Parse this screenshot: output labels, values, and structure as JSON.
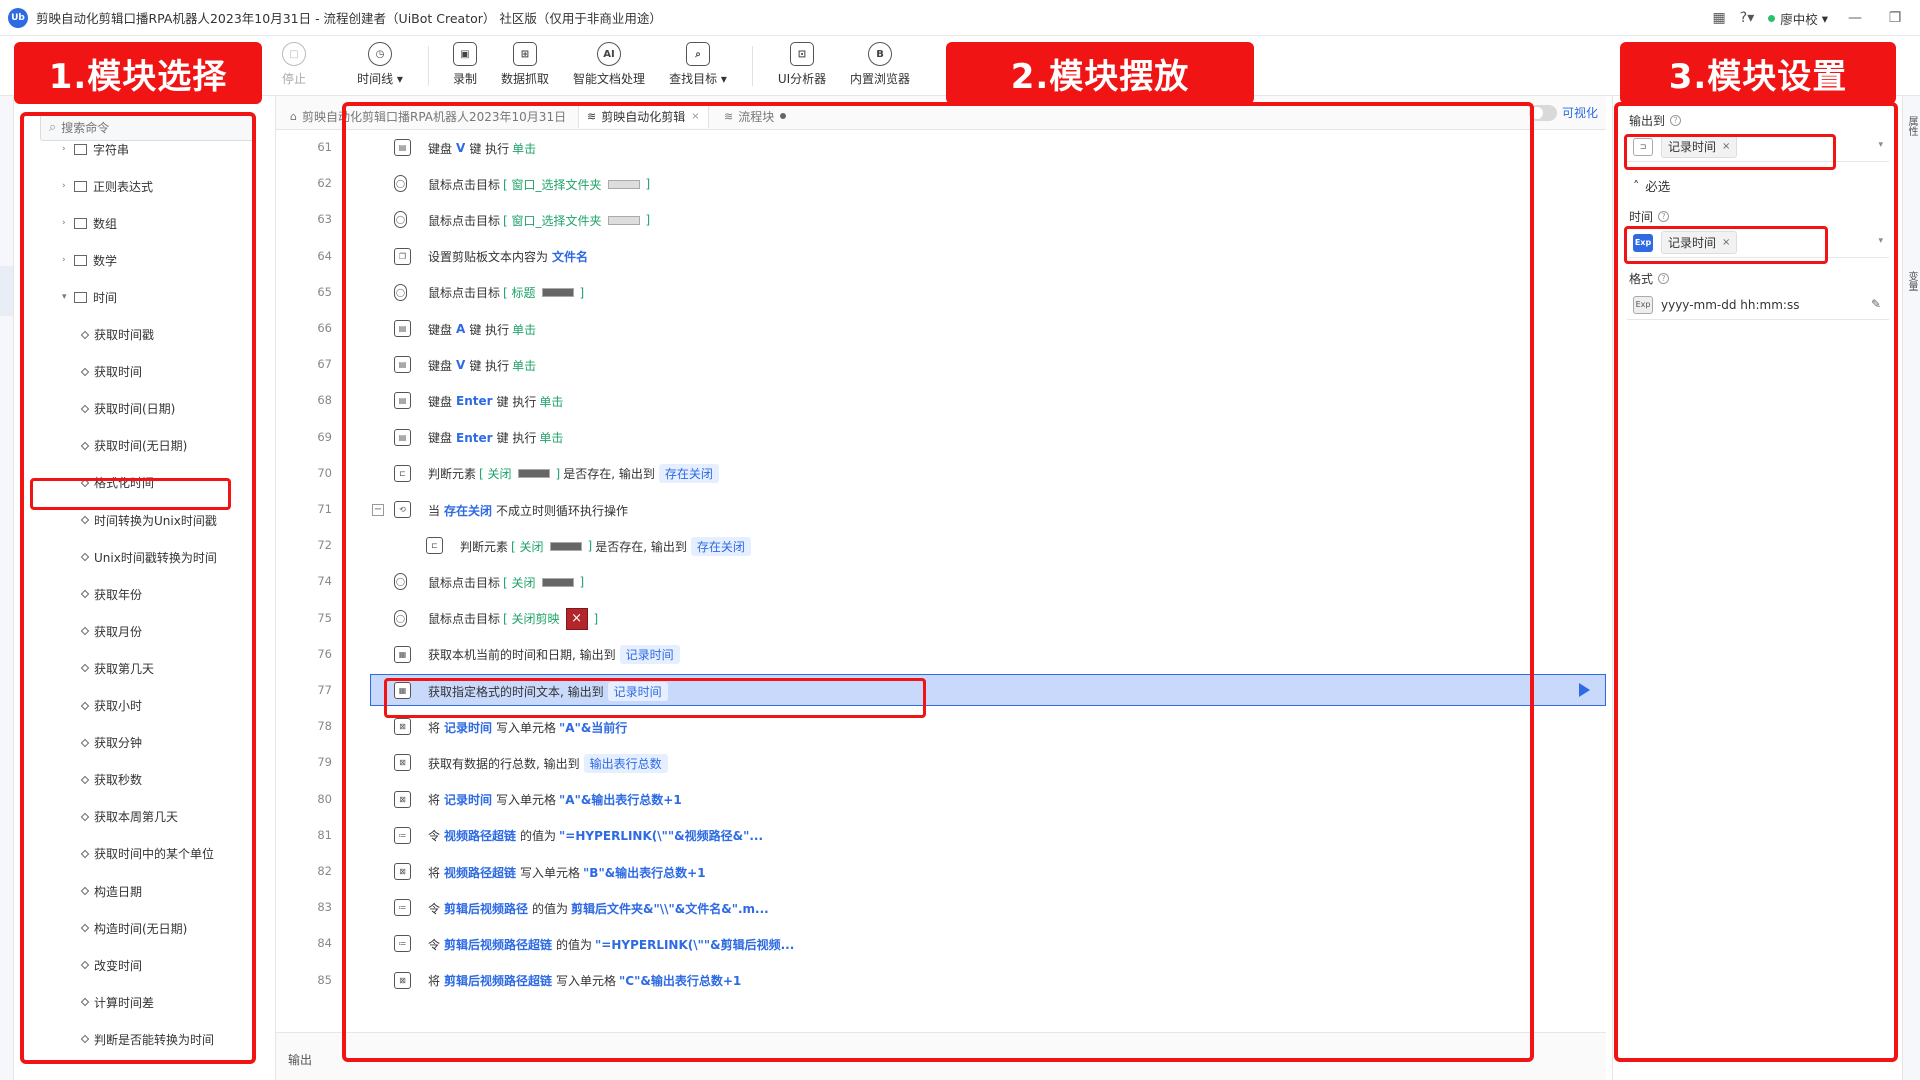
{
  "window": {
    "title": "剪映自动化剪辑口播RPA机器人2023年10月31日 - 流程创建者（UiBot Creator） 社区版（仅用于非商业用途）",
    "logo": "Ub",
    "user": "廖中校"
  },
  "toolbar": {
    "items": [
      {
        "label": "停止",
        "icon": "stop-icon",
        "glyph": "□"
      },
      {
        "label": "时间线 ▾",
        "icon": "clock-icon",
        "glyph": "◷"
      },
      {
        "label": "录制",
        "icon": "record-icon",
        "glyph": "▣"
      },
      {
        "label": "数据抓取",
        "icon": "data-grab-icon",
        "glyph": "⊞"
      },
      {
        "label": "智能文档处理",
        "icon": "ai-doc-icon",
        "glyph": "AI"
      },
      {
        "label": "查找目标 ▾",
        "icon": "find-target-icon",
        "glyph": "⌕"
      },
      {
        "label": "UI分析器",
        "icon": "ui-analyzer-icon",
        "glyph": "⊡"
      },
      {
        "label": "内置浏览器",
        "icon": "browser-icon",
        "glyph": "B"
      }
    ]
  },
  "annotations": {
    "panel1": "1.模块选择",
    "panel2": "2.模块摆放",
    "panel3": "3.模块设置"
  },
  "left": {
    "search_placeholder": "搜索命令",
    "tree": [
      {
        "label": "字符串",
        "kind": "folder"
      },
      {
        "label": "正则表达式",
        "kind": "folder"
      },
      {
        "label": "数组",
        "kind": "folder"
      },
      {
        "label": "数学",
        "kind": "folder"
      },
      {
        "label": "时间",
        "kind": "folder-open"
      },
      {
        "label": "获取时间戳",
        "kind": "leaf"
      },
      {
        "label": "获取时间",
        "kind": "leaf"
      },
      {
        "label": "获取时间(日期)",
        "kind": "leaf"
      },
      {
        "label": "获取时间(无日期)",
        "kind": "leaf"
      },
      {
        "label": "格式化时间",
        "kind": "leaf"
      },
      {
        "label": "时间转换为Unix时间戳",
        "kind": "leaf"
      },
      {
        "label": "Unix时间戳转换为时间",
        "kind": "leaf"
      },
      {
        "label": "获取年份",
        "kind": "leaf"
      },
      {
        "label": "获取月份",
        "kind": "leaf"
      },
      {
        "label": "获取第几天",
        "kind": "leaf"
      },
      {
        "label": "获取小时",
        "kind": "leaf"
      },
      {
        "label": "获取分钟",
        "kind": "leaf"
      },
      {
        "label": "获取秒数",
        "kind": "leaf"
      },
      {
        "label": "获取本周第几天",
        "kind": "leaf"
      },
      {
        "label": "获取时间中的某个单位",
        "kind": "leaf"
      },
      {
        "label": "构造日期",
        "kind": "leaf"
      },
      {
        "label": "构造时间(无日期)",
        "kind": "leaf"
      },
      {
        "label": "改变时间",
        "kind": "leaf"
      },
      {
        "label": "计算时间差",
        "kind": "leaf"
      },
      {
        "label": "判断是否能转换为时间",
        "kind": "leaf"
      }
    ]
  },
  "editor": {
    "tabs": [
      {
        "label": "剪映自动化剪辑口播RPA机器人2023年10月31日",
        "icon": "⌂"
      },
      {
        "label": "剪映自动化剪辑",
        "icon": "≋",
        "close": "×"
      },
      {
        "label": "流程块",
        "icon": "≋"
      }
    ],
    "visualize_label": "可视化",
    "output_label": "输出",
    "rows": [
      {
        "n": "61",
        "icon": "kbd",
        "parts": [
          [
            "t",
            "键盘"
          ],
          [
            "kw",
            "V"
          ],
          [
            "t",
            "键 执行"
          ],
          [
            "tg",
            "单击"
          ]
        ]
      },
      {
        "n": "62",
        "icon": "mouse",
        "parts": [
          [
            "t",
            "鼠标点击目标"
          ],
          [
            "tg",
            "[ 窗口_选择文件夹"
          ],
          [
            "thumbL",
            ""
          ],
          [
            "tg",
            "]"
          ]
        ]
      },
      {
        "n": "63",
        "icon": "mouse",
        "parts": [
          [
            "t",
            "鼠标点击目标"
          ],
          [
            "tg",
            "[ 窗口_选择文件夹"
          ],
          [
            "thumbL",
            ""
          ],
          [
            "tg",
            "]"
          ]
        ]
      },
      {
        "n": "64",
        "icon": "clip",
        "parts": [
          [
            "t",
            "设置剪贴板文本内容为"
          ],
          [
            "kw",
            "文件名"
          ]
        ]
      },
      {
        "n": "65",
        "icon": "mouse",
        "parts": [
          [
            "t",
            "鼠标点击目标"
          ],
          [
            "tg",
            "[ 标题"
          ],
          [
            "thumb",
            ""
          ],
          [
            "tg",
            "]"
          ]
        ]
      },
      {
        "n": "66",
        "icon": "kbd",
        "parts": [
          [
            "t",
            "键盘"
          ],
          [
            "kw",
            "A"
          ],
          [
            "t",
            "键 执行"
          ],
          [
            "tg",
            "单击"
          ]
        ]
      },
      {
        "n": "67",
        "icon": "kbd",
        "parts": [
          [
            "t",
            "键盘"
          ],
          [
            "kw",
            "V"
          ],
          [
            "t",
            "键 执行"
          ],
          [
            "tg",
            "单击"
          ]
        ]
      },
      {
        "n": "68",
        "icon": "kbd",
        "parts": [
          [
            "t",
            "键盘"
          ],
          [
            "kw",
            "Enter"
          ],
          [
            "t",
            "键 执行"
          ],
          [
            "tg",
            "单击"
          ]
        ]
      },
      {
        "n": "69",
        "icon": "kbd",
        "parts": [
          [
            "t",
            "键盘"
          ],
          [
            "kw",
            "Enter"
          ],
          [
            "t",
            "键 执行"
          ],
          [
            "tg",
            "单击"
          ]
        ]
      },
      {
        "n": "70",
        "icon": "judge",
        "parts": [
          [
            "t",
            "判断元素"
          ],
          [
            "tg",
            "[ 关闭"
          ],
          [
            "thumb",
            ""
          ],
          [
            "tg",
            "]"
          ],
          [
            "t",
            "是否存在, 输出到"
          ],
          [
            "var",
            "存在关闭"
          ]
        ]
      },
      {
        "n": "71",
        "icon": "loop",
        "fold": true,
        "parts": [
          [
            "t",
            "当"
          ],
          [
            "kw",
            "存在关闭"
          ],
          [
            "t",
            "不成立时则循环执行操作"
          ]
        ]
      },
      {
        "n": "72",
        "icon": "judge",
        "indent": true,
        "parts": [
          [
            "t",
            "判断元素"
          ],
          [
            "tg",
            "[ 关闭"
          ],
          [
            "thumb",
            ""
          ],
          [
            "tg",
            "]"
          ],
          [
            "t",
            "是否存在, 输出到"
          ],
          [
            "var",
            "存在关闭"
          ]
        ]
      },
      {
        "n": "74",
        "icon": "mouse",
        "parts": [
          [
            "t",
            "鼠标点击目标"
          ],
          [
            "tg",
            "[ 关闭"
          ],
          [
            "thumb",
            ""
          ],
          [
            "tg",
            "]"
          ]
        ]
      },
      {
        "n": "75",
        "icon": "mouse",
        "parts": [
          [
            "t",
            "鼠标点击目标"
          ],
          [
            "tg",
            "[ 关闭剪映"
          ],
          [
            "redx",
            "×"
          ],
          [
            "tg",
            "]"
          ]
        ]
      },
      {
        "n": "76",
        "icon": "cal",
        "parts": [
          [
            "t",
            "获取本机当前的时间和日期, 输出到"
          ],
          [
            "var",
            "记录时间"
          ]
        ]
      },
      {
        "n": "77",
        "icon": "cal",
        "selected": true,
        "parts": [
          [
            "t",
            "获取指定格式的时间文本, 输出到"
          ],
          [
            "var",
            "记录时间"
          ]
        ]
      },
      {
        "n": "78",
        "icon": "xl",
        "parts": [
          [
            "t",
            "将"
          ],
          [
            "kw",
            "记录时间"
          ],
          [
            "t",
            "写入单元格"
          ],
          [
            "str",
            "\"A\"&当前行"
          ]
        ]
      },
      {
        "n": "79",
        "icon": "xl",
        "parts": [
          [
            "t",
            "获取有数据的行总数, 输出到"
          ],
          [
            "var",
            "输出表行总数"
          ]
        ]
      },
      {
        "n": "80",
        "icon": "xl",
        "parts": [
          [
            "t",
            "将"
          ],
          [
            "kw",
            "记录时间"
          ],
          [
            "t",
            "写入单元格"
          ],
          [
            "str",
            "\"A\"&输出表行总数+1"
          ]
        ]
      },
      {
        "n": "81",
        "icon": "assign",
        "parts": [
          [
            "t",
            "令"
          ],
          [
            "kw",
            "视频路径超链"
          ],
          [
            "t",
            "的值为"
          ],
          [
            "str",
            "\"=HYPERLINK(\\\"\"&视频路径&\"..."
          ]
        ]
      },
      {
        "n": "82",
        "icon": "xl",
        "parts": [
          [
            "t",
            "将"
          ],
          [
            "kw",
            "视频路径超链"
          ],
          [
            "t",
            "写入单元格"
          ],
          [
            "str",
            "\"B\"&输出表行总数+1"
          ]
        ]
      },
      {
        "n": "83",
        "icon": "assign",
        "parts": [
          [
            "t",
            "令"
          ],
          [
            "kw",
            "剪辑后视频路径"
          ],
          [
            "t",
            "的值为"
          ],
          [
            "str",
            "剪辑后文件夹&\"\\\\\"&文件名&\".m..."
          ]
        ]
      },
      {
        "n": "84",
        "icon": "assign",
        "parts": [
          [
            "t",
            "令"
          ],
          [
            "kw",
            "剪辑后视频路径超链"
          ],
          [
            "t",
            "的值为"
          ],
          [
            "str",
            "\"=HYPERLINK(\\\"\"&剪辑后视频..."
          ]
        ]
      },
      {
        "n": "85",
        "icon": "xl",
        "parts": [
          [
            "t",
            "将"
          ],
          [
            "kw",
            "剪辑后视频路径超链"
          ],
          [
            "t",
            "写入单元格"
          ],
          [
            "str",
            "\"C\"&输出表行总数+1"
          ]
        ]
      }
    ]
  },
  "right": {
    "output_to_label": "输出到",
    "output_to_value": "记录时间",
    "required_section": "必选",
    "time_label": "时间",
    "time_icon": "Exp",
    "time_value": "记录时间",
    "format_label": "格式",
    "format_icon": "Exp",
    "format_value": "yyyy-mm-dd hh:mm:ss",
    "strip_tab_1": "属性",
    "strip_tab_2": "变量"
  },
  "icon_glyphs": {
    "kbd": "▤",
    "mouse": "◯",
    "clip": "❐",
    "judge": "⊏",
    "loop": "⟲",
    "cal": "▦",
    "xl": "⊠",
    "assign": "≔"
  },
  "colors": {
    "accent": "#2d6ae3",
    "annotation_red": "#f01414",
    "selected_row": "#c8d9fb"
  }
}
